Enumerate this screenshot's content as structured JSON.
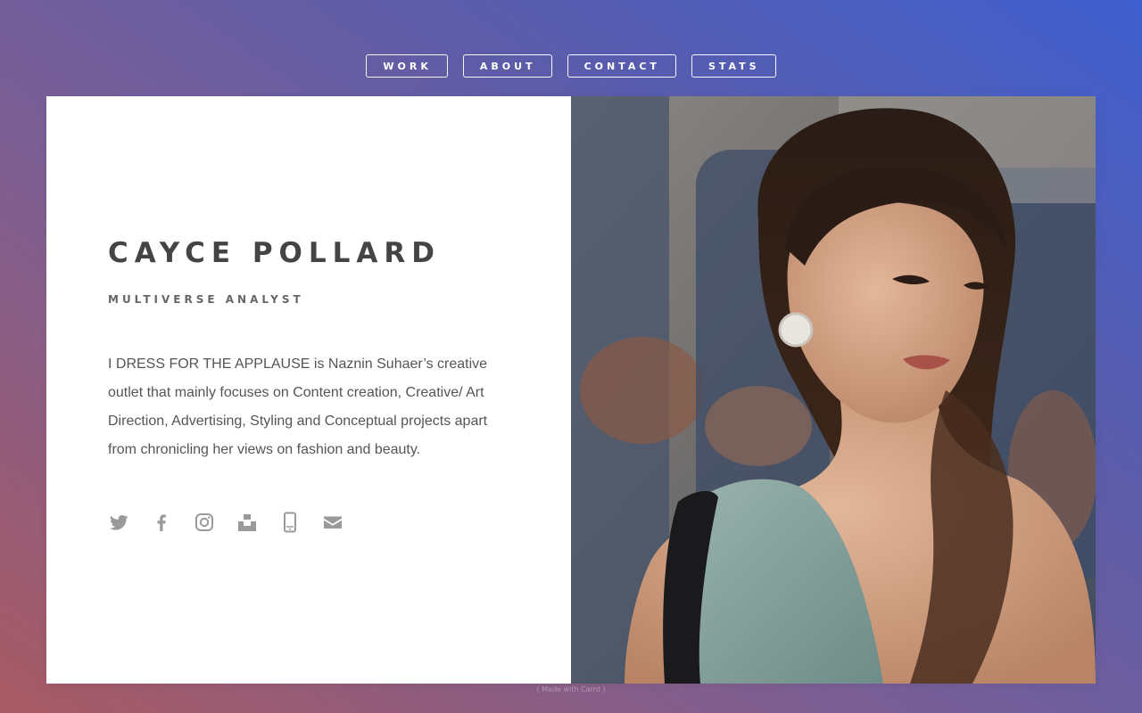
{
  "nav": {
    "items": [
      {
        "label": "WORK"
      },
      {
        "label": "ABOUT"
      },
      {
        "label": "CONTACT"
      },
      {
        "label": "STATS"
      }
    ]
  },
  "profile": {
    "name": "CAYCE POLLARD",
    "title": "MULTIVERSE ANALYST",
    "bio": "I DRESS FOR THE APPLAUSE is Naznin Suhaer’s creative outlet that mainly focuses on Content creation, Creative/ Art Direction, Advertising, Styling and Conceptual projects apart from chronicling her views on fashion and beauty."
  },
  "social": {
    "icons": [
      "twitter-icon",
      "facebook-icon",
      "instagram-icon",
      "unsplash-icon",
      "phone-icon",
      "email-icon"
    ]
  },
  "footer": {
    "text": "( Made with Carrd )"
  },
  "colors": {
    "icon_gray": "#9a9a9a",
    "text_dark": "#444444"
  }
}
